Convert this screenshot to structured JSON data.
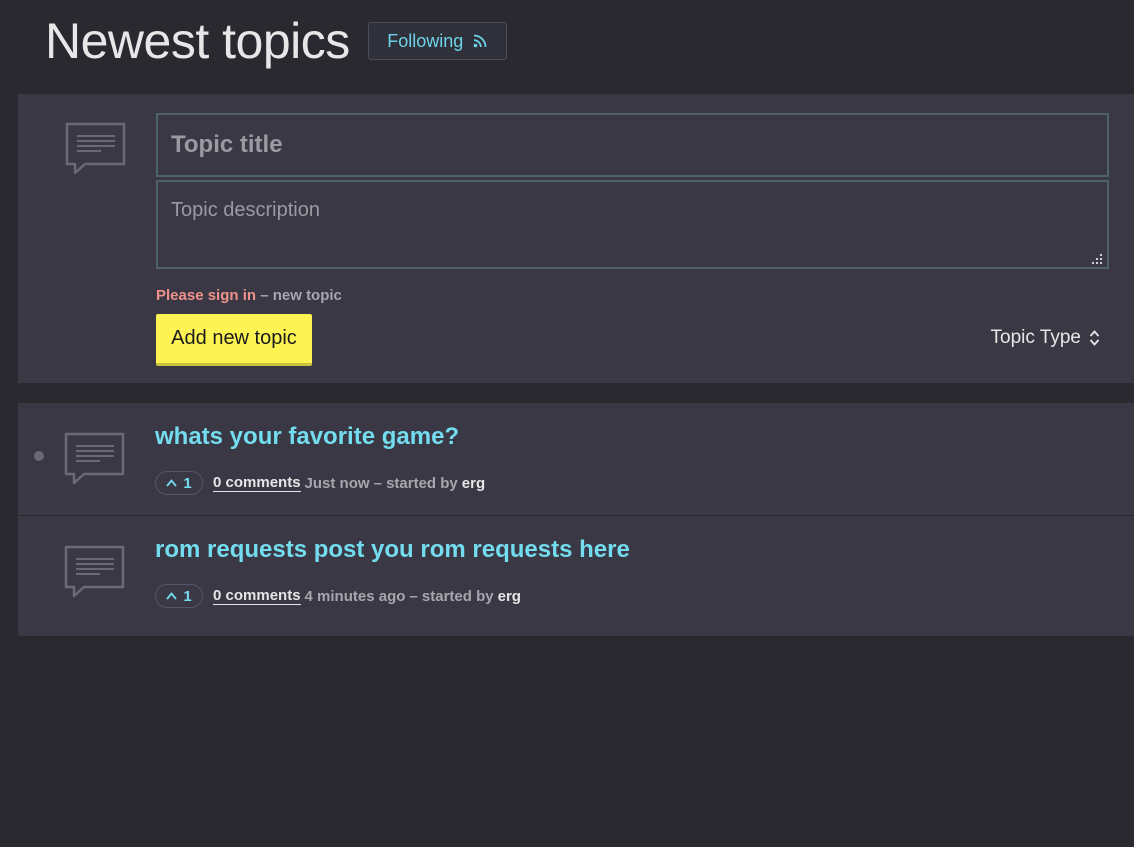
{
  "header": {
    "title": "Newest topics",
    "follow_label": "Following",
    "follow_icon": "rss-icon"
  },
  "composer": {
    "icon": "comment-bubble-icon",
    "title_placeholder": "Topic title",
    "description_placeholder": "Topic description",
    "signin_link": "Please sign in",
    "signin_rest": " – new topic",
    "add_button": "Add new topic",
    "topic_type_label": "Topic Type",
    "topic_type_icon": "sort-chevrons-icon"
  },
  "topics": [
    {
      "title": "whats your favorite game?",
      "votes": "1",
      "comments": "0 comments",
      "time": "Just now",
      "started_by": "– started by",
      "author": "erg",
      "unread": true
    },
    {
      "title": "rom requests post you rom requests here",
      "votes": "1",
      "comments": "0 comments",
      "time": "4 minutes ago",
      "started_by": "– started by",
      "author": "erg",
      "unread": false
    }
  ],
  "colors": {
    "background": "#2b2930",
    "panel": "#393844",
    "accent_cyan": "#74dcef",
    "signin_red": "#f0928b",
    "button_yellow": "#fdf453"
  }
}
